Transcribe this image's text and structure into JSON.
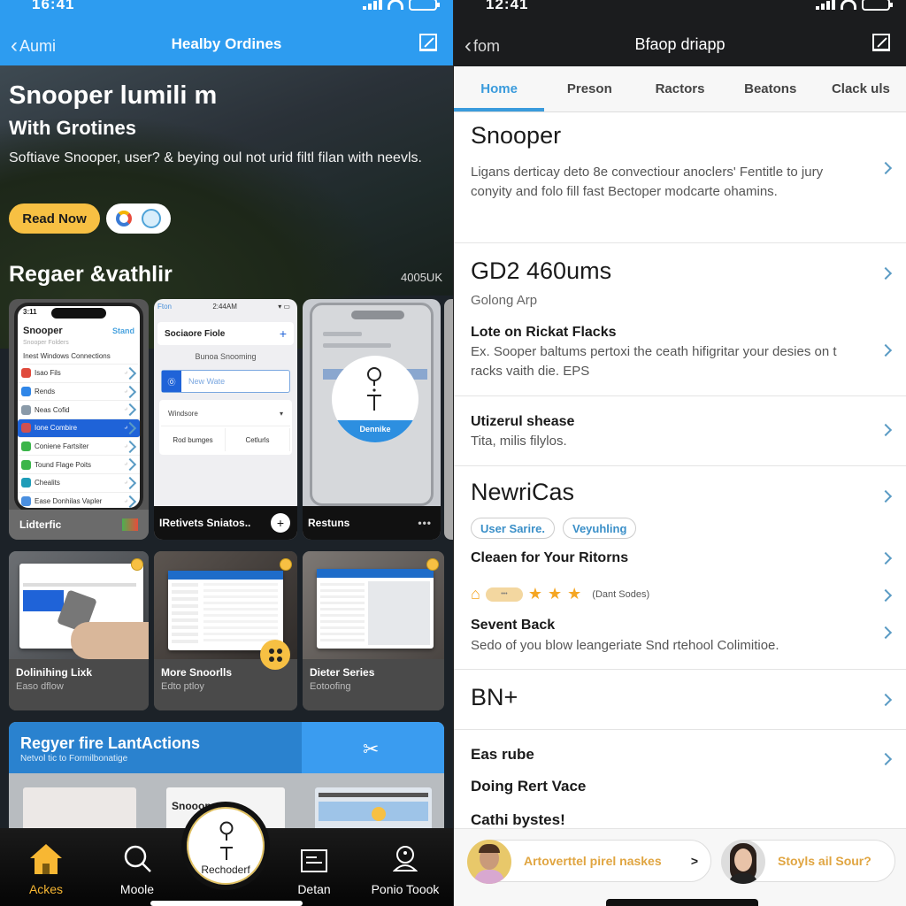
{
  "left": {
    "status": {
      "time": "16:41"
    },
    "nav": {
      "back": "Aumi",
      "title": "Healby Ordines",
      "edit_icon": "edit-icon"
    },
    "hero": {
      "title_line1": "Snooper lumili m",
      "title_line2": "With Grotines",
      "description": "Softiave Snooper, user? & beying oul not urid filtl filan with neevls.",
      "read_now": "Read Now",
      "social_icons": [
        "google-icon",
        "chat-icon"
      ]
    },
    "section": {
      "title": "Regaer &vathlir",
      "count": "4005UK"
    },
    "mockups": [
      {
        "status_time": "3:11",
        "title": "Snooper",
        "action": "Stand",
        "subtitle": "Snooper Folders",
        "section": "Inest Windows Connections",
        "rows": [
          {
            "label": "Isao Fils",
            "color": "#e04a3c"
          },
          {
            "label": "Rends",
            "color": "#2f86e8"
          },
          {
            "label": "Neas Cofid",
            "color": "#8a9aa8"
          },
          {
            "label": "Ione Combire",
            "color": "#d05050",
            "selected": true
          },
          {
            "label": "Coniene Fartsiter",
            "color": "#3bb54a"
          },
          {
            "label": "Tound Flage Poits",
            "color": "#3bb54a"
          },
          {
            "label": "Chealits",
            "color": "#1e9cb8"
          },
          {
            "label": "Ease Donhilas Vapler",
            "color": "#4a8fe0"
          }
        ],
        "caption": "Lidterfic"
      },
      {
        "status_left": "Fton",
        "status_time": "2:44AM",
        "header": "Sociaore Fiole",
        "subheader": "Bunoa Snooming",
        "input_placeholder": "New Wate",
        "select_value": "Windsore",
        "buttons": [
          "Rod bumges",
          "Cetlurls"
        ],
        "caption": "IRetivets Sniatos.."
      },
      {
        "overlay_label": "Dennike",
        "caption": "Restuns"
      }
    ],
    "cards": [
      {
        "title": "Dolinihing Lixk",
        "subtitle": "Easo dflow"
      },
      {
        "title": "More Snoorlls",
        "subtitle": "Edto ptloy"
      },
      {
        "title": "Dieter Series",
        "subtitle": "Eotoofing"
      }
    ],
    "promo": {
      "title": "Regyer fire LantActions",
      "subtitle": "Netvol tic to Formilbonatige",
      "thumb_text": "Snoooper"
    },
    "tabbar": [
      {
        "label": "Ackes",
        "icon": "home-icon",
        "active": true
      },
      {
        "label": "Moole",
        "icon": "search-icon"
      },
      {
        "label": "Rechoderf",
        "icon": "key-icon",
        "center": true
      },
      {
        "label": "Detan",
        "icon": "document-icon"
      },
      {
        "label": "Ponio Toook",
        "icon": "profile-icon"
      }
    ]
  },
  "right": {
    "status": {
      "time": "12:41"
    },
    "nav": {
      "back": "fom",
      "title": "Bfaop driapp"
    },
    "tabs": [
      {
        "label": "Home",
        "active": true
      },
      {
        "label": "Preson"
      },
      {
        "label": "Ractors"
      },
      {
        "label": "Beatons"
      },
      {
        "label": "Clack uls"
      }
    ],
    "items": {
      "snooper": {
        "title": "Snooper",
        "description": "Ligans derticay deto 8e convectiour anoclers' Fentitle to jury conyity and folo fill fast Bectoper modcarte ohamins."
      },
      "gd2": {
        "title": "GD2 460ums",
        "subtitle": "Golong Arp",
        "heading": "Lote on Rickat Flacks",
        "description": "Ex. Sooper baltums pertoxi the ceath hifigritar your desies on t racks vaith die. EPS"
      },
      "utizerul": {
        "title": "Utizerul shease",
        "description": "Tita, milis filylos."
      },
      "newricas": {
        "title": "NewriCas",
        "chips": [
          "User Sarire.",
          "Veyuhling"
        ],
        "heading": "Cleaen for Your Ritorns",
        "rating": 3,
        "rating_note": "(Dant Sodes)",
        "heading2": "Sevent Back",
        "description": "Sedo of you blow leangeriate Snd rtehool Colimitioe."
      },
      "bn": {
        "title": "BN+"
      },
      "list": [
        "Eas rube",
        "Doing Rert Vace",
        "Cathi bystes!"
      ]
    },
    "footer": [
      {
        "label": "Artoverttel pirel naskes",
        "arrow": ">"
      },
      {
        "label": "Stoyls ail Sour?"
      }
    ],
    "colors": {
      "accent": "#3a9bdc",
      "highlight": "#e0a541"
    }
  },
  "colors": {
    "left_nav": "#2d9cf0",
    "yellow": "#f7c043",
    "dark_nav": "#1b1c1e"
  }
}
